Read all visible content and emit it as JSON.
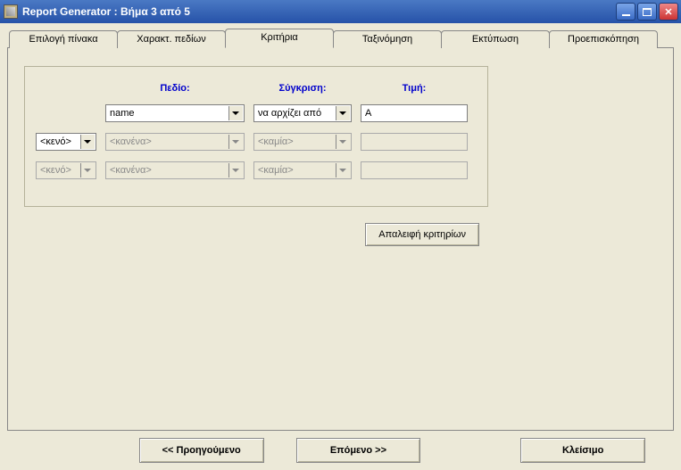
{
  "window": {
    "title": "Report Generator :  Βήμα 3 από 5"
  },
  "tabs": [
    {
      "label": "Επιλογή πίνακα"
    },
    {
      "label": "Χαρακτ. πεδίων"
    },
    {
      "label": "Κριτήρια"
    },
    {
      "label": "Ταξινόμηση"
    },
    {
      "label": "Εκτύπωση"
    },
    {
      "label": "Προεπισκόπηση"
    }
  ],
  "criteria": {
    "headers": {
      "field": "Πεδίο:",
      "compare": "Σύγκριση:",
      "value": "Τιμή:"
    },
    "rows": [
      {
        "conj": "",
        "field": "name",
        "compare": "να αρχίζει από",
        "value": "Α",
        "enabled": true
      },
      {
        "conj": "<κενό>",
        "field": "<κανένα>",
        "compare": "<καμία>",
        "value": "",
        "enabled": false,
        "conjEnabled": true
      },
      {
        "conj": "<κενό>",
        "field": "<κανένα>",
        "compare": "<καμία>",
        "value": "",
        "enabled": false,
        "conjEnabled": false
      }
    ],
    "clearBtn": "Απαλειφή κριτηρίων"
  },
  "nav": {
    "prev": "<<  Προηγούμενο",
    "next": "Επόμενο  >>",
    "close": "Κλείσιμο"
  }
}
